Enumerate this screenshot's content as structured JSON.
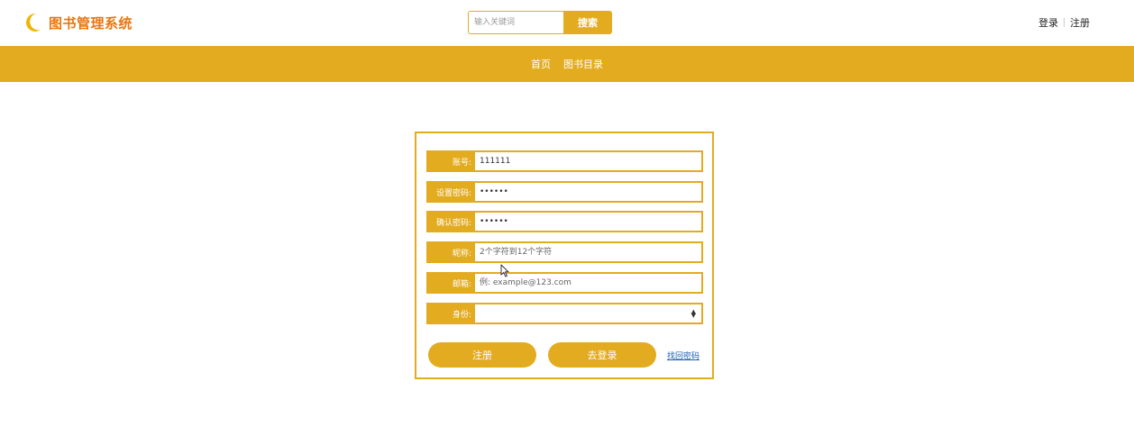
{
  "header": {
    "logo_text": "图书管理系统",
    "search_placeholder": "输入关键词",
    "search_button": "搜索",
    "login_link": "登录",
    "register_link": "注册"
  },
  "nav": {
    "items": [
      "首页",
      "图书目录"
    ]
  },
  "form": {
    "account_label": "账号:",
    "account_value": "111111",
    "password_label": "设置密码:",
    "password_value": "111111",
    "confirm_label": "确认密码:",
    "confirm_value": "111111",
    "nickname_label": "昵称:",
    "nickname_placeholder": "2个字符到12个字符",
    "email_label": "邮箱:",
    "email_placeholder": "例: example@123.com",
    "role_label": "身份:",
    "role_value": "",
    "register_button": "注册",
    "login_button": "去登录",
    "forgot_link": "找回密码"
  },
  "colors": {
    "accent": "#e3ac20",
    "logo": "#e8760f",
    "link": "#1a5fb4"
  },
  "icons": {
    "logo": "crescent-moon-icon",
    "select": "updown-arrows-icon",
    "cursor": "mouse-pointer-icon"
  }
}
